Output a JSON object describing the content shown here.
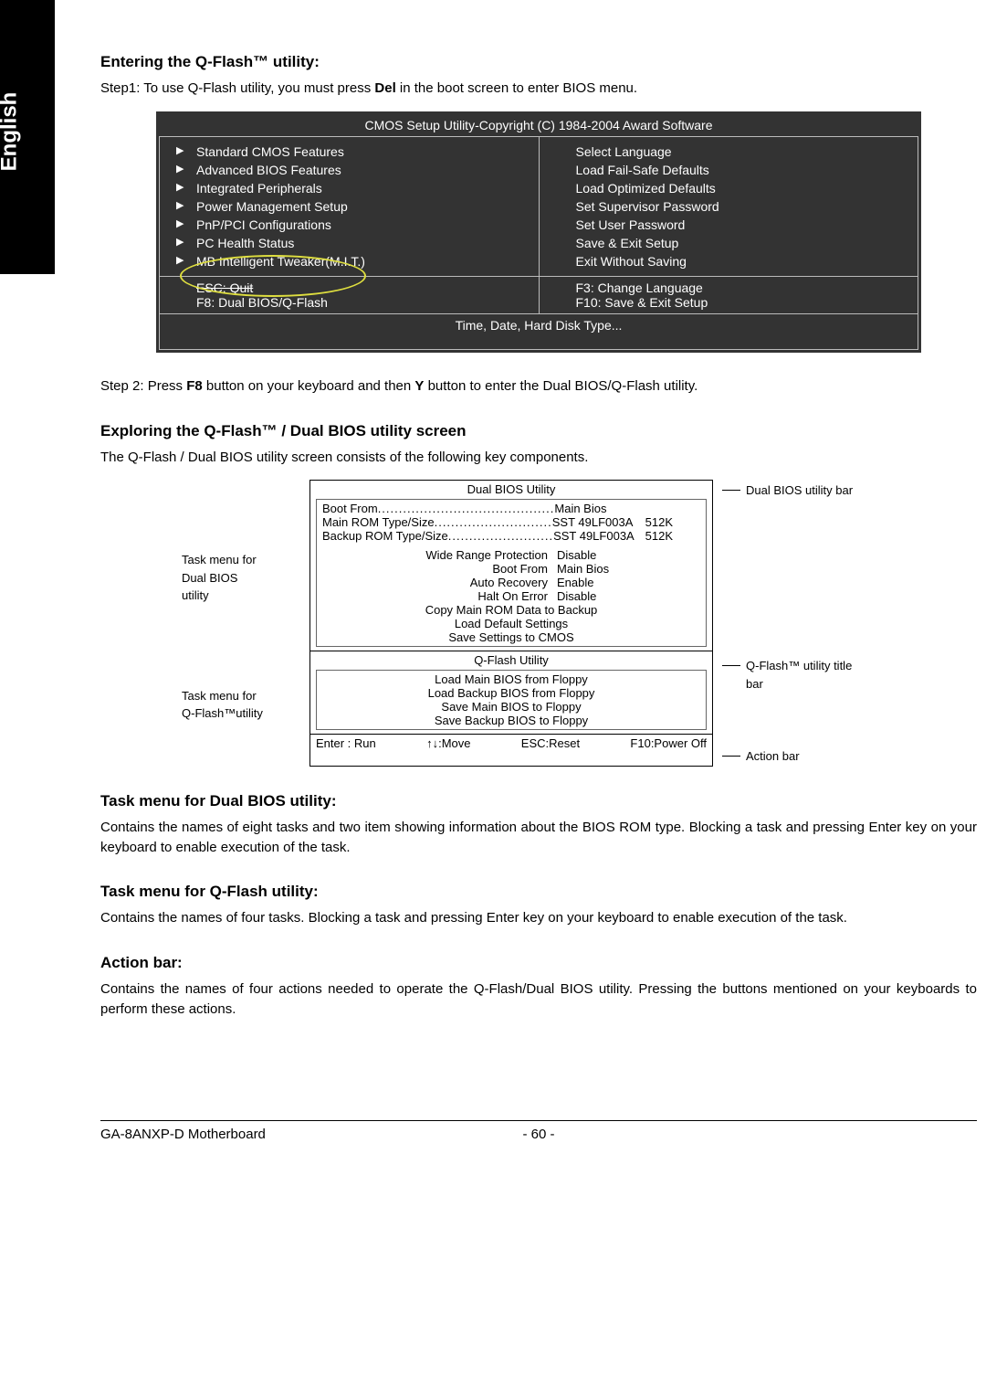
{
  "langTab": "English",
  "h1": "Entering the Q-Flash™ utility:",
  "step1_a": "Step1: To use Q-Flash utility, you must press ",
  "step1_b": "Del",
  "step1_c": " in the boot screen to enter BIOS menu.",
  "cmos": {
    "title": "CMOS Setup Utility-Copyright (C) 1984-2004 Award Software",
    "left": [
      "Standard CMOS Features",
      "Advanced BIOS Features",
      "Integrated Peripherals",
      "Power Management Setup",
      "PnP/PCI Configurations",
      "PC Health Status",
      "MB Intelligent Tweaker(M.I.T.)"
    ],
    "right": [
      "Select Language",
      "Load Fail-Safe Defaults",
      "Load Optimized Defaults",
      "Set Supervisor Password",
      "Set User Password",
      "Save & Exit Setup",
      "Exit Without Saving"
    ],
    "act_l1": "ESC: Quit",
    "act_l2": "F8: Dual BIOS/Q-Flash",
    "act_r1": "F3: Change Language",
    "act_r2": "F10: Save & Exit Setup",
    "info": "Time, Date, Hard Disk Type..."
  },
  "step2_a": "Step 2: Press ",
  "step2_b": "F8",
  "step2_c": " button on your keyboard and then ",
  "step2_d": "Y",
  "step2_e": " button to enter the Dual BIOS/Q-Flash utility.",
  "h2": "Exploring the Q-Flash™ / Dual BIOS utility screen",
  "p2": "The Q-Flash / Dual BIOS utility screen consists of the following key components.",
  "leftLabels": {
    "l1a": "Task menu for",
    "l1b": "Dual BIOS",
    "l1c": "utility",
    "l2a": "Task menu for",
    "l2b": "Q-Flash™utility"
  },
  "rightLabels": {
    "r1": "Dual BIOS utility bar",
    "r2a": "Q-Flash™ utility title",
    "r2b": "bar",
    "r3": "Action bar"
  },
  "dual": {
    "title": "Dual BIOS Utility",
    "row1_l": "Boot From",
    "row1_r": "Main Bios",
    "row2_l": "Main ROM Type/Size",
    "row2_r": "SST 49LF003A",
    "row2_v": "512K",
    "row3_l": "Backup ROM Type/Size",
    "row3_r": "SST 49LF003A",
    "row3_v": "512K",
    "opts": [
      {
        "l": "Wide Range Protection",
        "r": "Disable"
      },
      {
        "l": "Boot From",
        "r": "Main Bios"
      },
      {
        "l": "Auto Recovery",
        "r": "Enable"
      },
      {
        "l": "Halt On Error",
        "r": "Disable"
      }
    ],
    "cmds": [
      "Copy Main ROM Data to Backup",
      "Load Default Settings",
      "Save Settings to CMOS"
    ],
    "qtitle": "Q-Flash Utility",
    "qcmds": [
      "Load Main BIOS from Floppy",
      "Load Backup BIOS from Floppy",
      "Save Main BIOS to Floppy",
      "Save Backup BIOS to Floppy"
    ],
    "actions": {
      "a1": "Enter : Run",
      "a2": "↑↓:Move",
      "a3": "ESC:Reset",
      "a4": "F10:Power Off"
    }
  },
  "h3": "Task menu for Dual BIOS utility:",
  "p3": "Contains the names of eight tasks and two item showing information about the BIOS ROM type. Blocking a task and pressing Enter key on your keyboard to enable execution of the task.",
  "h4": "Task menu for Q-Flash utility:",
  "p4": "Contains the names of four tasks. Blocking a task and pressing Enter key on your keyboard to enable execution of the task.",
  "h5": "Action bar:",
  "p5": "Contains the names of four actions needed to operate the Q-Flash/Dual BIOS utility. Pressing the buttons mentioned on your keyboards to perform these actions.",
  "footer": {
    "left": "GA-8ANXP-D Motherboard",
    "center": "- 60 -"
  }
}
